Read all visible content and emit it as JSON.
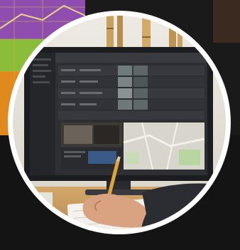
{
  "image": {
    "subject": "",
    "colors": {
      "background": "#141414",
      "frame_ring": "#ffffff",
      "wall": "#e2ded6",
      "bamboo": "#c9a15e",
      "monitor_bezel": "#1c1d20",
      "screen_ui": "#2e2f33",
      "map": "#d8d6cc",
      "desk": "#c79a5d",
      "skin": "#d9a281",
      "sleeve": "#2b2d33",
      "pencil": "#e0a43a",
      "bg_chart_purple": "#8f4db0",
      "bg_chart_green": "#8cbd3a",
      "bg_chart_orange": "#e08a1e"
    }
  }
}
